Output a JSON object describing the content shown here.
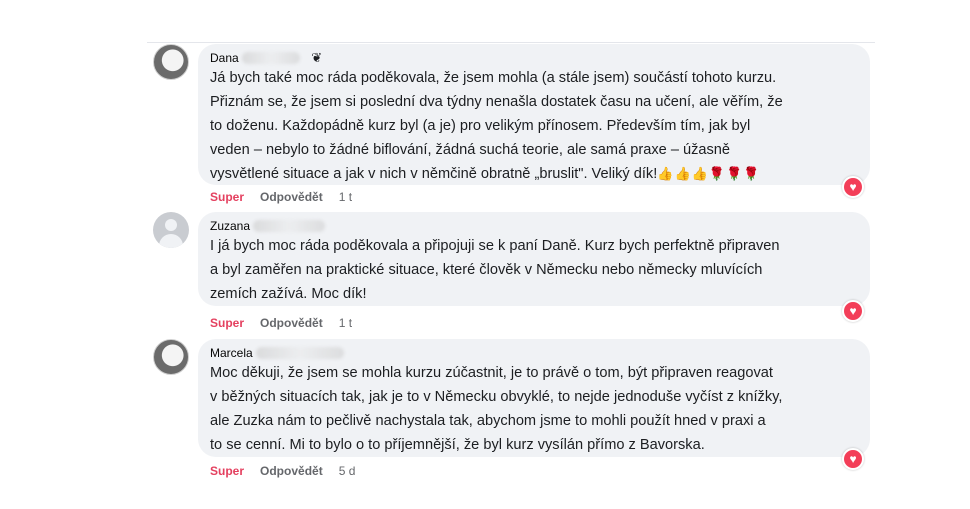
{
  "colors": {
    "bubble_bg": "#f0f2f5",
    "reaction_label": "#e4405f",
    "meta_text": "#65676b",
    "heart": "#f33e58"
  },
  "comments": [
    {
      "author": "Dana",
      "author_icon": "badge-icon",
      "text": "Já bych také moc ráda poděkovala, že jsem mohla (a stále jsem) součástí tohoto kurzu.\nPřiznám se, že jsem si poslední dva týdny nenašla dostatek času na učení, ale věřím, že\nto doženu. Každopádně kurz byl (a je) pro velikým přínosem. Především tím, jak byl\nveden – nebylo to žádné biflování, žádná suchá teorie, ale samá praxe – úžasně\nvysvětlené situace a jak v nich v němčině obratně „bruslit\". Veliký dík!",
      "emoji": "👍👍👍🌹🌹🌹",
      "reaction_label": "Super",
      "reply_label": "Odpovědět",
      "time": "1 t",
      "reaction_icon": "heart-icon"
    },
    {
      "author": "Zuzana",
      "text": "I já bych moc ráda poděkovala a připojuji se k paní Daně. Kurz bych perfektně připraven\na byl zaměřen na praktické situace, které člověk v Německu nebo německy mluvících\nzemích zažívá. Moc dík!",
      "reaction_label": "Super",
      "reply_label": "Odpovědět",
      "time": "1 t",
      "reaction_icon": "heart-icon"
    },
    {
      "author": "Marcela",
      "text": "Moc děkuji, že jsem se mohla kurzu zúčastnit, je to právě o tom, být připraven reagovat\nv běžných situacích tak, jak je to v Německu obvyklé, to nejde jednoduše vyčíst z knížky,\nale Zuzka nám to pečlivě nachystala tak, abychom jsme to mohli použít hned v praxi a\nto se cenní. Mi to bylo o to příjemnější, že byl kurz vysílán přímo z Bavorska.",
      "reaction_label": "Super",
      "reply_label": "Odpovědět",
      "time": "5 d",
      "reaction_icon": "heart-icon"
    }
  ]
}
